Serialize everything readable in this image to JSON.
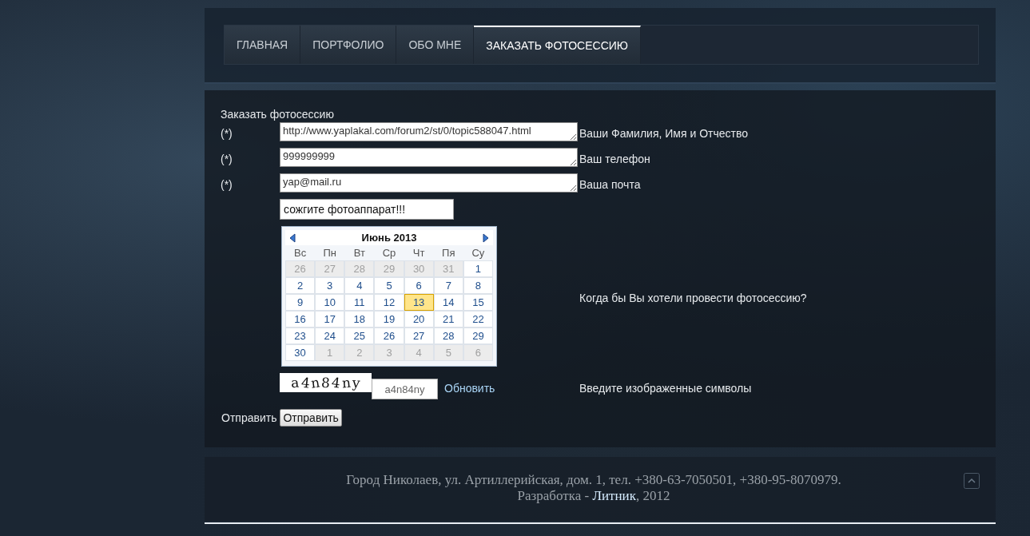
{
  "nav": {
    "tabs": [
      {
        "label": "ГЛАВНАЯ",
        "selected": false
      },
      {
        "label": "ПОРТФОЛИО",
        "selected": false
      },
      {
        "label": "ОБО МНЕ",
        "selected": false
      },
      {
        "label": "ЗАКАЗАТЬ ФОТОСЕССИЮ",
        "selected": true
      }
    ]
  },
  "form": {
    "title": "Заказать фотосессию",
    "fields": [
      {
        "required_mark": "(*)",
        "value": "http://www.yaplakal.com/forum2/st/0/topic588047.html",
        "label": "Ваши Фамилия, Имя и Отчество"
      },
      {
        "required_mark": "(*)",
        "value": "999999999",
        "label": "Ваш телефон"
      },
      {
        "required_mark": "(*)",
        "value": "yap@mail.ru",
        "label": "Ваша почта"
      }
    ],
    "date_field": {
      "value": "сожгите фотоаппарат!!!"
    },
    "calendar": {
      "month": "Июнь 2013",
      "weekdays": [
        "Вс",
        "Пн",
        "Вт",
        "Ср",
        "Чт",
        "Пя",
        "Су"
      ],
      "weeks": [
        [
          {
            "day": "26",
            "muted": true,
            "selected": false
          },
          {
            "day": "27",
            "muted": true,
            "selected": false
          },
          {
            "day": "28",
            "muted": true,
            "selected": false
          },
          {
            "day": "29",
            "muted": true,
            "selected": false
          },
          {
            "day": "30",
            "muted": true,
            "selected": false
          },
          {
            "day": "31",
            "muted": true,
            "selected": false
          },
          {
            "day": "1",
            "muted": false,
            "selected": false
          }
        ],
        [
          {
            "day": "2",
            "muted": false,
            "selected": false
          },
          {
            "day": "3",
            "muted": false,
            "selected": false
          },
          {
            "day": "4",
            "muted": false,
            "selected": false
          },
          {
            "day": "5",
            "muted": false,
            "selected": false
          },
          {
            "day": "6",
            "muted": false,
            "selected": false
          },
          {
            "day": "7",
            "muted": false,
            "selected": false
          },
          {
            "day": "8",
            "muted": false,
            "selected": false
          }
        ],
        [
          {
            "day": "9",
            "muted": false,
            "selected": false
          },
          {
            "day": "10",
            "muted": false,
            "selected": false
          },
          {
            "day": "11",
            "muted": false,
            "selected": false
          },
          {
            "day": "12",
            "muted": false,
            "selected": false
          },
          {
            "day": "13",
            "muted": false,
            "selected": true
          },
          {
            "day": "14",
            "muted": false,
            "selected": false
          },
          {
            "day": "15",
            "muted": false,
            "selected": false
          }
        ],
        [
          {
            "day": "16",
            "muted": false,
            "selected": false
          },
          {
            "day": "17",
            "muted": false,
            "selected": false
          },
          {
            "day": "18",
            "muted": false,
            "selected": false
          },
          {
            "day": "19",
            "muted": false,
            "selected": false
          },
          {
            "day": "20",
            "muted": false,
            "selected": false
          },
          {
            "day": "21",
            "muted": false,
            "selected": false
          },
          {
            "day": "22",
            "muted": false,
            "selected": false
          }
        ],
        [
          {
            "day": "23",
            "muted": false,
            "selected": false
          },
          {
            "day": "24",
            "muted": false,
            "selected": false
          },
          {
            "day": "25",
            "muted": false,
            "selected": false
          },
          {
            "day": "26",
            "muted": false,
            "selected": false
          },
          {
            "day": "27",
            "muted": false,
            "selected": false
          },
          {
            "day": "28",
            "muted": false,
            "selected": false
          },
          {
            "day": "29",
            "muted": false,
            "selected": false
          }
        ],
        [
          {
            "day": "30",
            "muted": false,
            "selected": false
          },
          {
            "day": "1",
            "muted": true,
            "selected": false
          },
          {
            "day": "2",
            "muted": true,
            "selected": false
          },
          {
            "day": "3",
            "muted": true,
            "selected": false
          },
          {
            "day": "4",
            "muted": true,
            "selected": false
          },
          {
            "day": "5",
            "muted": true,
            "selected": false
          },
          {
            "day": "6",
            "muted": true,
            "selected": false
          }
        ]
      ]
    },
    "date_label": "Когда бы Вы хотели провести фотосессию?",
    "captcha": {
      "image_text": "a4n84ny",
      "value": "a4n84ny",
      "refresh_link": "Обновить",
      "label": "Введите изображенные символы"
    },
    "submit": {
      "label": "Отправить",
      "button": "Отправить"
    }
  },
  "footer": {
    "address": "Город Николаев, ул. Артиллерийская, дом. 1, тел. +380-63-7050501, +380-95-8070979.",
    "credit_before": "Разработка - ",
    "credit_link": "Литник",
    "credit_after": ", 2012"
  }
}
